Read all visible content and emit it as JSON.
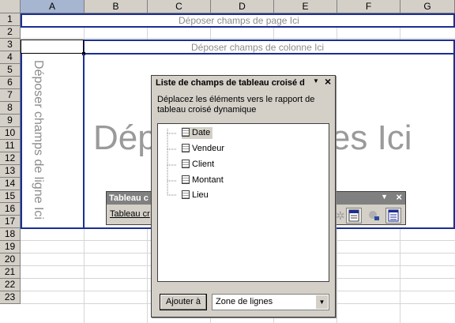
{
  "columns": [
    "A",
    "B",
    "C",
    "D",
    "E",
    "F",
    "G"
  ],
  "rows": [
    "1",
    "2",
    "3",
    "4",
    "5",
    "6",
    "7",
    "8",
    "9",
    "10",
    "11",
    "12",
    "13",
    "14",
    "15",
    "16",
    "17",
    "18",
    "19",
    "20",
    "21",
    "22",
    "23"
  ],
  "pivot": {
    "page_drop": "Déposer champs de page Ici",
    "column_drop": "Déposer champs de colonne Ici",
    "row_drop": "Déposer champs de ligne Ici",
    "data_drop": "Déposer données Ici"
  },
  "toolbar": {
    "title": "Tableau c",
    "menu_label": "Tableau cr"
  },
  "dialog": {
    "title": "Liste de champs de tableau croisé d",
    "instructions": "Déplacez les éléments vers le rapport de tableau croisé dynamique",
    "fields": [
      "Date",
      "Vendeur",
      "Client",
      "Montant",
      "Lieu"
    ],
    "add_button": "Ajouter à",
    "area_select": "Zone de lignes"
  }
}
